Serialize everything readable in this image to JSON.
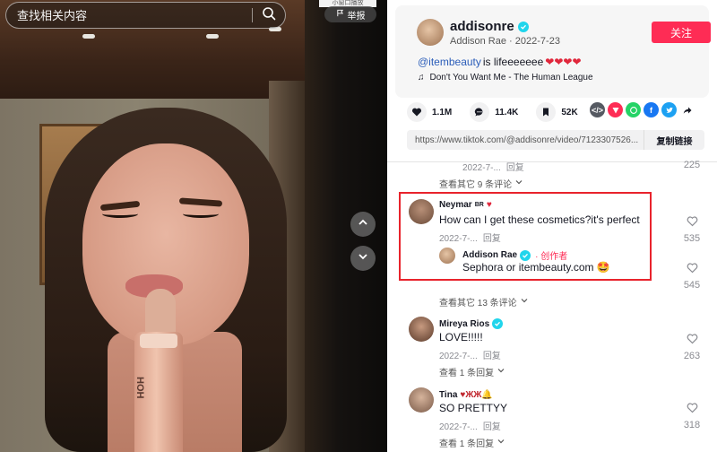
{
  "video": {
    "search_placeholder": "查找相关内容",
    "mini_window_label": "小窗口播放",
    "report_label": "举报",
    "product_text": "HOH"
  },
  "author": {
    "username": "addisonre",
    "display_name": "Addison Rae",
    "date": "2022-7-23",
    "follow_label": "关注",
    "caption_mention": "@itembeauty",
    "caption_text": " is lifeeeeeee",
    "music": "Don't You Want Me - The Human League"
  },
  "stats": {
    "likes": "1.1M",
    "comments": "11.4K",
    "saves": "52K"
  },
  "share": {
    "link": "https://www.tiktok.com/@addisonre/video/7123307526...",
    "copy_label": "复制链接"
  },
  "comments": {
    "top_partial": {
      "date": "2022-7-...",
      "reply_label": "回复",
      "likes": "225",
      "view_more": "查看其它 9 条评论"
    },
    "items": [
      {
        "username": "Neymar",
        "username_suffix": "BR",
        "text": "How can I get these cosmetics?it's perfect",
        "date": "2022-7-...",
        "reply_label": "回复",
        "likes": "535",
        "reply": {
          "username": "Addison Rae",
          "creator_badge": "· 创作者",
          "text": "Sephora or itembeauty.com 🤩",
          "likes": "545"
        },
        "view_more": "查看其它 13 条评论"
      },
      {
        "username": "Mireya Rios",
        "text": "LOVE!!!!!",
        "date": "2022-7-...",
        "reply_label": "回复",
        "likes": "263",
        "view_more": "查看 1 条回复"
      },
      {
        "username": "Tina",
        "username_suffix": "♥ЖЖ🔔",
        "text": "SO PRETTYY",
        "date": "2022-7-...",
        "reply_label": "回复",
        "likes": "318",
        "view_more": "查看 1 条回复"
      }
    ]
  },
  "colors": {
    "accent": "#fe2c55",
    "highlight": "#e8232c",
    "verified": "#20d5ec",
    "mention": "#2b5db9"
  },
  "icons": [
    "search-icon",
    "flag-icon",
    "chevron-up-icon",
    "chevron-down-icon",
    "heart-icon",
    "comment-icon",
    "bookmark-icon",
    "music-note-icon",
    "verified-icon",
    "embed-icon",
    "send-icon",
    "whatsapp-icon",
    "facebook-icon",
    "twitter-icon",
    "share-arrow-icon"
  ]
}
